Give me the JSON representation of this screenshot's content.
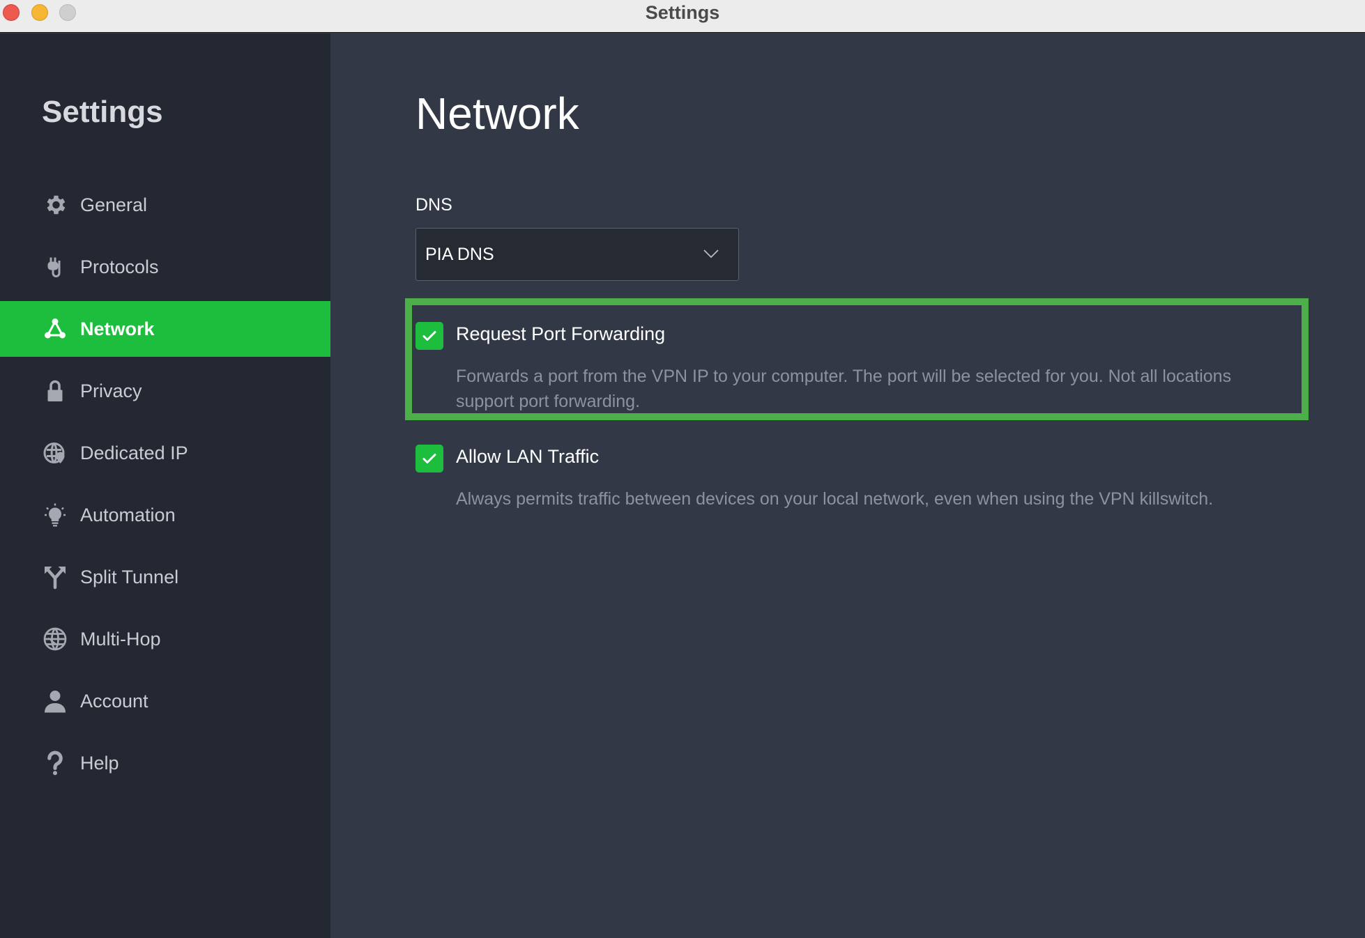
{
  "window": {
    "title": "Settings"
  },
  "sidebar": {
    "heading": "Settings",
    "items": [
      {
        "label": "General",
        "icon": "gear-icon",
        "active": false
      },
      {
        "label": "Protocols",
        "icon": "plug-icon",
        "active": false
      },
      {
        "label": "Network",
        "icon": "network-icon",
        "active": true
      },
      {
        "label": "Privacy",
        "icon": "lock-icon",
        "active": false
      },
      {
        "label": "Dedicated IP",
        "icon": "globe-pin-icon",
        "active": false
      },
      {
        "label": "Automation",
        "icon": "lightbulb-icon",
        "active": false
      },
      {
        "label": "Split Tunnel",
        "icon": "split-arrow-icon",
        "active": false
      },
      {
        "label": "Multi-Hop",
        "icon": "globe-icon",
        "active": false
      },
      {
        "label": "Account",
        "icon": "user-icon",
        "active": false
      },
      {
        "label": "Help",
        "icon": "question-icon",
        "active": false
      }
    ]
  },
  "main": {
    "title": "Network",
    "dns": {
      "label": "DNS",
      "selected": "PIA DNS"
    },
    "options": [
      {
        "title": "Request Port Forwarding",
        "description": "Forwards a port from the VPN IP to your computer. The port will be selected for you. Not all locations support port forwarding.",
        "checked": true
      },
      {
        "title": "Allow LAN Traffic",
        "description": "Always permits traffic between devices on your local network, even when using the VPN killswitch.",
        "checked": true
      }
    ]
  },
  "colors": {
    "accent": "#1dbe3d",
    "highlight": "#4caf4a",
    "sidebar_bg": "#242832",
    "main_bg": "#323846"
  }
}
